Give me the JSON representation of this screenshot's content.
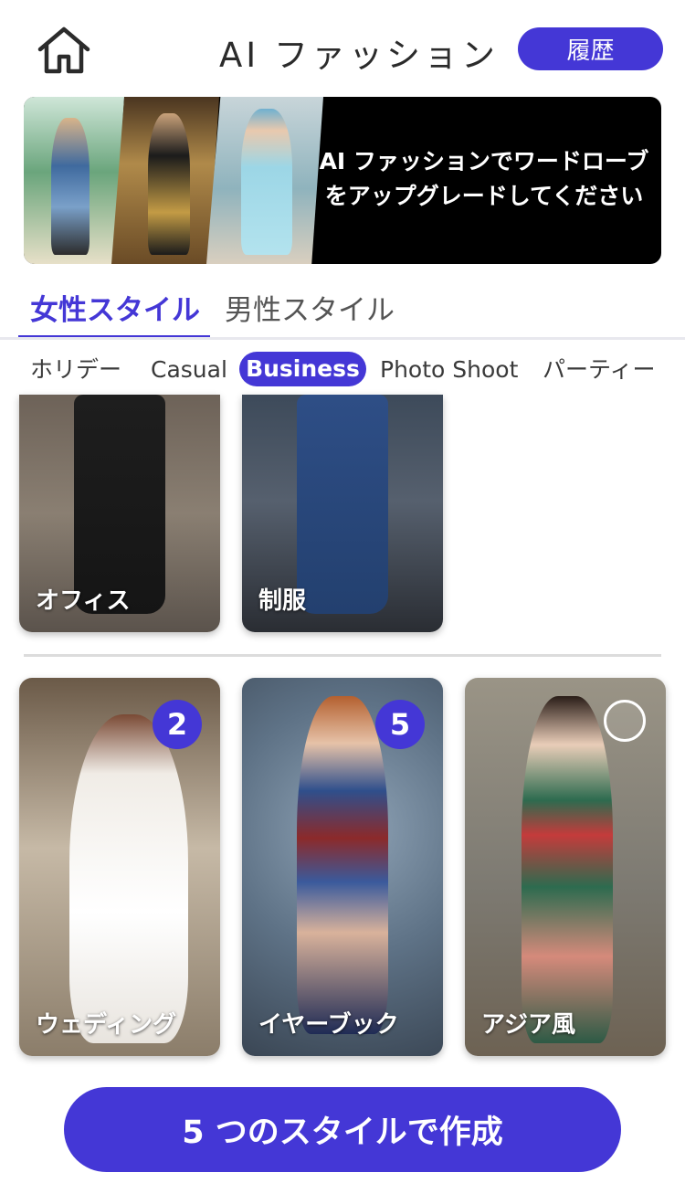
{
  "header": {
    "title": "AI ファッション",
    "history_label": "履歴",
    "home_icon": "home-icon"
  },
  "banner": {
    "text_line1": "AI ファッションでワードローブ",
    "text_line2": "をアップグレードしてください"
  },
  "tabs": [
    {
      "label": "女性スタイル",
      "active": true
    },
    {
      "label": "男性スタイル",
      "active": false
    }
  ],
  "categories": [
    {
      "label": "ホリデー",
      "active": false
    },
    {
      "label": "Casual",
      "active": false
    },
    {
      "label": "Business",
      "active": true
    },
    {
      "label": "Photo Shoot",
      "active": false
    },
    {
      "label": "パーティー",
      "active": false
    }
  ],
  "business_styles": [
    {
      "label": "オフィス"
    },
    {
      "label": "制服"
    }
  ],
  "selected_styles": [
    {
      "label": "ウェディング",
      "count": "2"
    },
    {
      "label": "イヤーブック",
      "count": "5"
    },
    {
      "label": "アジア風",
      "count": ""
    }
  ],
  "create_button": {
    "label": "5 つのスタイルで作成"
  },
  "colors": {
    "accent": "#4437d6"
  }
}
